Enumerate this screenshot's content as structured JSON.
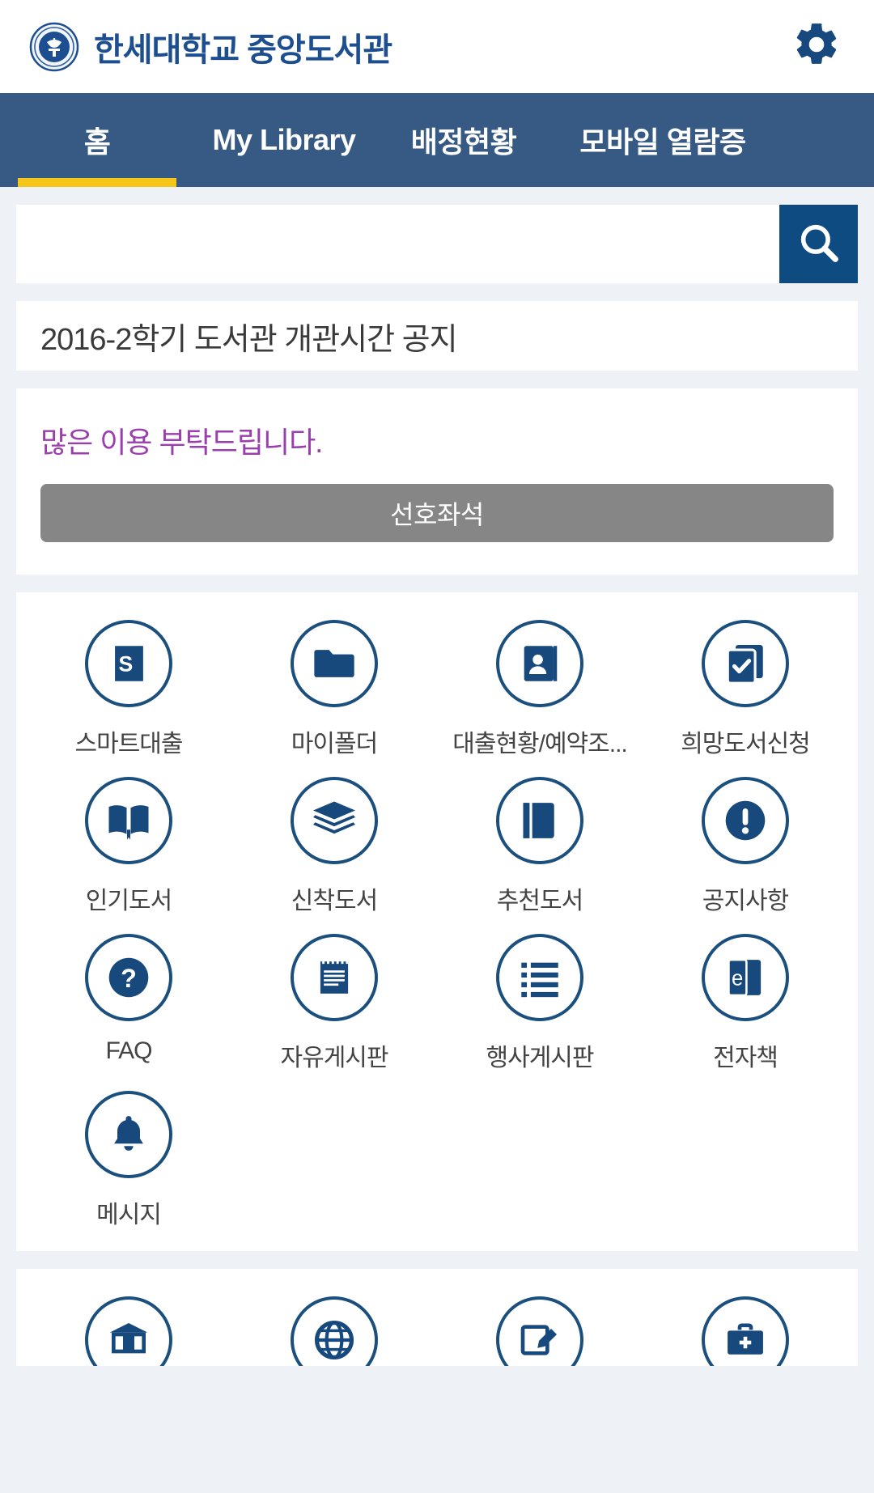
{
  "header": {
    "logo_alt": "한세대학교 엠블럼",
    "title": "한세대학교 중앙도서관",
    "settings_label": "설정"
  },
  "nav": {
    "items": [
      {
        "label": "홈",
        "active": true
      },
      {
        "label": "My Library",
        "active": false
      },
      {
        "label": "배정현황",
        "active": false
      },
      {
        "label": "모바일 열람증",
        "active": false
      }
    ],
    "active_indicator_color": "#f5c518",
    "background_color": "#375a85"
  },
  "search": {
    "value": "",
    "placeholder": "",
    "button_label": "검색",
    "button_color": "#0d4b80",
    "icon": "search-icon"
  },
  "notice": {
    "title": "2016-2학기 도서관 개관시간 공지",
    "body": "많은 이용 부탁드립니다.",
    "body_color": "#9b3fae",
    "seat_button_label": "선호좌석",
    "seat_button_color": "#868686"
  },
  "menu_grid": {
    "accent_color": "#1b4f7e",
    "items": [
      {
        "label": "스마트대출",
        "icon": "smart-loan-book-icon"
      },
      {
        "label": "마이폴더",
        "icon": "folder-icon"
      },
      {
        "label": "대출현황/예약조...",
        "icon": "id-card-icon"
      },
      {
        "label": "희망도서신청",
        "icon": "check-books-icon"
      },
      {
        "label": "인기도서",
        "icon": "open-book-icon"
      },
      {
        "label": "신착도서",
        "icon": "book-stack-icon"
      },
      {
        "label": "추천도서",
        "icon": "closed-book-icon"
      },
      {
        "label": "공지사항",
        "icon": "exclamation-icon"
      },
      {
        "label": "FAQ",
        "icon": "question-mark-icon"
      },
      {
        "label": "자유게시판",
        "icon": "notepad-icon"
      },
      {
        "label": "행사게시판",
        "icon": "list-icon"
      },
      {
        "label": "전자책",
        "icon": "ebook-icon"
      },
      {
        "label": "메시지",
        "icon": "bell-icon"
      }
    ]
  },
  "secondary_grid": {
    "items": [
      {
        "icon": "library-building-icon"
      },
      {
        "icon": "globe-icon"
      },
      {
        "icon": "pencil-edit-icon"
      },
      {
        "icon": "briefcase-plus-icon"
      }
    ]
  }
}
